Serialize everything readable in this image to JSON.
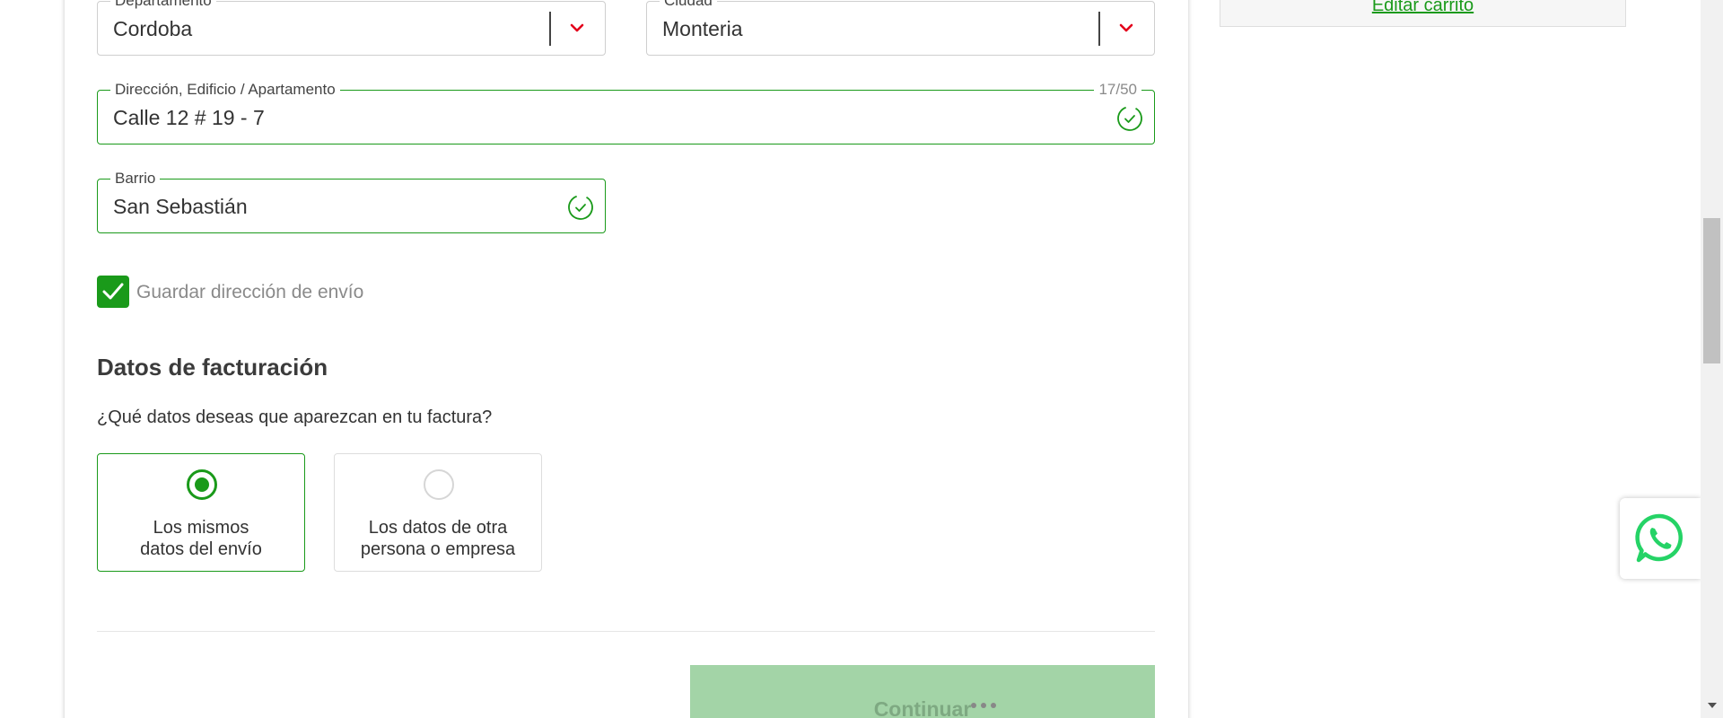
{
  "shipping": {
    "department": {
      "label": "Departamento",
      "value": "Cordoba"
    },
    "city": {
      "label": "Ciudad",
      "value": "Monteria"
    },
    "address": {
      "label": "Dirección, Edificio / Apartamento",
      "value": "Calle 12 # 19 - 7",
      "counter": "17/50"
    },
    "neighborhood": {
      "label": "Barrio",
      "value": "San Sebastián"
    },
    "save_address": {
      "label": "Guardar dirección de envío",
      "checked": true
    }
  },
  "billing": {
    "title": "Datos de facturación",
    "question": "¿Qué datos deseas que aparezcan en tu factura?",
    "options": [
      {
        "line1": "Los mismos",
        "line2": "datos del envío",
        "selected": true
      },
      {
        "line1": "Los datos de otra",
        "line2": "persona o empresa",
        "selected": false
      }
    ]
  },
  "actions": {
    "continue_label": "Continuar"
  },
  "sidebar": {
    "edit_cart_label": "Editar carrito"
  },
  "colors": {
    "accent_green": "#1a9a1a",
    "chevron_red": "#e3001b",
    "whatsapp_green": "#25d366",
    "button_disabled": "#a3d4a7"
  },
  "icons": {
    "valid": "check-circle-icon",
    "select": "chevron-down-icon",
    "chat": "whatsapp-icon"
  }
}
